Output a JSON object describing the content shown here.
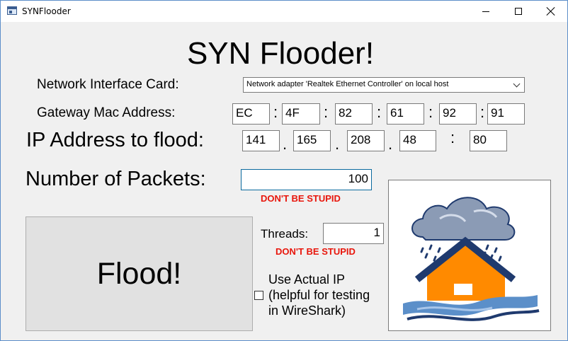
{
  "window": {
    "title": "SYNFlooder"
  },
  "header": {
    "title": "SYN Flooder!"
  },
  "nic": {
    "label": "Network Interface Card:",
    "selected": "Network adapter 'Realtek Ethernet Controller' on local host"
  },
  "gateway": {
    "label": "Gateway Mac Address:",
    "octets": [
      "EC",
      "4F",
      "82",
      "61",
      "92",
      "91"
    ],
    "separator": ":"
  },
  "ip": {
    "label": "IP Address to flood:",
    "octets": [
      "141",
      "165",
      "208",
      "48"
    ],
    "dot": ".",
    "port_separator": ":",
    "port": "80"
  },
  "packets": {
    "label": "Number of Packets:",
    "value": "100",
    "warning": "DON'T BE STUPID"
  },
  "threads": {
    "label": "Threads:",
    "value": "1",
    "warning": "DON'T BE STUPID"
  },
  "flood_button": {
    "label": "Flood!"
  },
  "use_actual_ip": {
    "checked": false,
    "label_lines": [
      "Use Actual IP",
      "(helpful for testing",
      "in WireShark)"
    ]
  },
  "colors": {
    "warning": "#e8160c",
    "house_orange": "#ff8a00",
    "roof_navy": "#1f3a6e",
    "wave_blue": "#5b8fc9",
    "cloud_gray": "#8b9bb5"
  },
  "image": {
    "icon": "storm-cloud-flood-house-icon"
  }
}
